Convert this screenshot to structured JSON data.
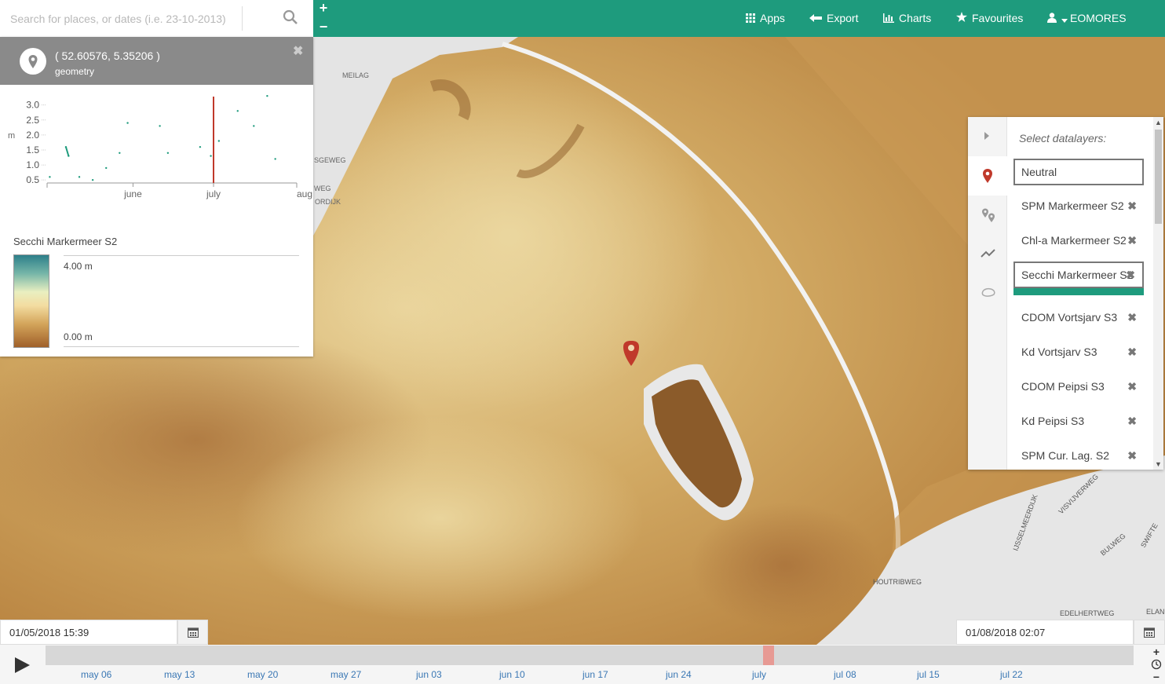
{
  "search": {
    "placeholder": "Search for places, or dates (i.e. 23-10-2013)",
    "icon": "search-icon"
  },
  "nav": {
    "apps": "Apps",
    "export": "Export",
    "charts": "Charts",
    "favourites": "Favourites",
    "user": "EOMORES"
  },
  "location": {
    "coords": "( 52.60576, 5.35206 )",
    "subtitle": "geometry"
  },
  "chart_data": {
    "type": "scatter",
    "ylabel": "m",
    "ylim": [
      0.4,
      3.2
    ],
    "yticks": [
      "0.5",
      "1.0",
      "1.5",
      "2.0",
      "2.5",
      "3.0"
    ],
    "xticks": [
      "june",
      "july",
      "aug"
    ],
    "current_marker": "2018-07-01",
    "color": "#1e9b7d",
    "marker_color": "#c0392b",
    "points": [
      {
        "x": "2018-05-01",
        "y": 0.6
      },
      {
        "x": "2018-05-07",
        "y": 1.6
      },
      {
        "x": "2018-05-08",
        "y": 1.3
      },
      {
        "x": "2018-05-12",
        "y": 0.6
      },
      {
        "x": "2018-05-17",
        "y": 0.5
      },
      {
        "x": "2018-05-22",
        "y": 0.9
      },
      {
        "x": "2018-05-27",
        "y": 1.4
      },
      {
        "x": "2018-05-30",
        "y": 2.4
      },
      {
        "x": "2018-06-11",
        "y": 2.3
      },
      {
        "x": "2018-06-14",
        "y": 1.4
      },
      {
        "x": "2018-06-26",
        "y": 1.6
      },
      {
        "x": "2018-06-30",
        "y": 1.3
      },
      {
        "x": "2018-07-03",
        "y": 1.8
      },
      {
        "x": "2018-07-10",
        "y": 2.8
      },
      {
        "x": "2018-07-16",
        "y": 2.3
      },
      {
        "x": "2018-07-21",
        "y": 3.3
      },
      {
        "x": "2018-07-24",
        "y": 1.2
      }
    ]
  },
  "legend": {
    "title": "Secchi Markermeer S2",
    "max": "4.00 m",
    "min": "0.00 m"
  },
  "layers": {
    "heading": "Select datalayers:",
    "items": [
      "Neutral",
      "SPM Markermeer S2",
      "Chl-a Markermeer S2",
      "Secchi Markermeer S2",
      "CDOM Vortsjarv S3",
      "Kd Vortsjarv S3",
      "CDOM Peipsi S3",
      "Kd Peipsi S3",
      "SPM Cur. Lag. S2"
    ],
    "selected": "Secchi Markermeer S2",
    "accent": "#1e9b7d"
  },
  "map_labels": [
    "MEILAG",
    "SGEWEG",
    "WEG",
    "ORDIJK",
    "HOUTRIBWEG",
    "EDELHERTWEG",
    "ELAN",
    "VISVIJVERWEG",
    "BULWEG",
    "SWIFTE",
    "IJSSELMEERDIJK"
  ],
  "timeline": {
    "start": "01/05/2018 15:39",
    "end": "01/08/2018 02:07",
    "ticks": [
      "may 06",
      "may 13",
      "may 20",
      "may 27",
      "jun 03",
      "jun 10",
      "jun 17",
      "jun 24",
      "july",
      "jul 08",
      "jul 15",
      "jul 22"
    ]
  },
  "colors": {
    "brand": "#1e9b7d",
    "pin": "#c0392b"
  }
}
